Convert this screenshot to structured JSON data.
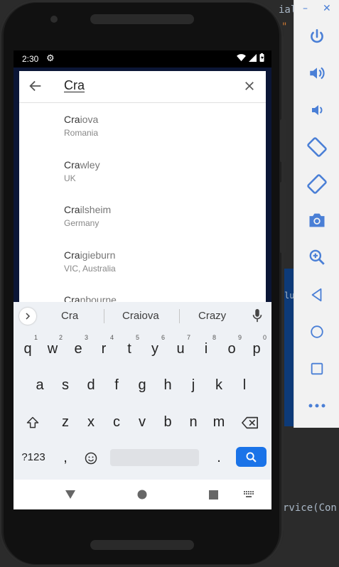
{
  "ide": {
    "code_top": "ial",
    "code_bottom": "rvice(Con",
    "code_mid": "lu"
  },
  "toolbar": {
    "minimize": "–",
    "close": "✕",
    "buttons": [
      "power-icon",
      "volume-up-icon",
      "volume-down-icon",
      "rotate-left-icon",
      "rotate-right-icon",
      "camera-icon",
      "zoom-icon",
      "back-icon",
      "home-icon",
      "overview-icon",
      "more-icon"
    ]
  },
  "statusbar": {
    "time": "2:30"
  },
  "search": {
    "query": "Cra"
  },
  "results": [
    {
      "match": "Cra",
      "rest": "iova",
      "sub": "Romania"
    },
    {
      "match": "Cra",
      "rest": "wley",
      "sub": "UK"
    },
    {
      "match": "Cra",
      "rest": "ilsheim",
      "sub": "Germany"
    },
    {
      "match": "Cra",
      "rest": "igieburn",
      "sub": "VIC, Australia"
    },
    {
      "match": "Cra",
      "rest": "nbourne",
      "sub": ""
    }
  ],
  "keyboard": {
    "suggestions": [
      "Cra",
      "Craiova",
      "Crazy"
    ],
    "row1": [
      {
        "k": "q",
        "n": "1"
      },
      {
        "k": "w",
        "n": "2"
      },
      {
        "k": "e",
        "n": "3"
      },
      {
        "k": "r",
        "n": "4"
      },
      {
        "k": "t",
        "n": "5"
      },
      {
        "k": "y",
        "n": "6"
      },
      {
        "k": "u",
        "n": "7"
      },
      {
        "k": "i",
        "n": "8"
      },
      {
        "k": "o",
        "n": "9"
      },
      {
        "k": "p",
        "n": "0"
      }
    ],
    "row2": [
      "a",
      "s",
      "d",
      "f",
      "g",
      "h",
      "j",
      "k",
      "l"
    ],
    "row3": [
      "z",
      "x",
      "c",
      "v",
      "b",
      "n",
      "m"
    ],
    "symbols": "?123",
    "comma": ",",
    "period": "."
  }
}
